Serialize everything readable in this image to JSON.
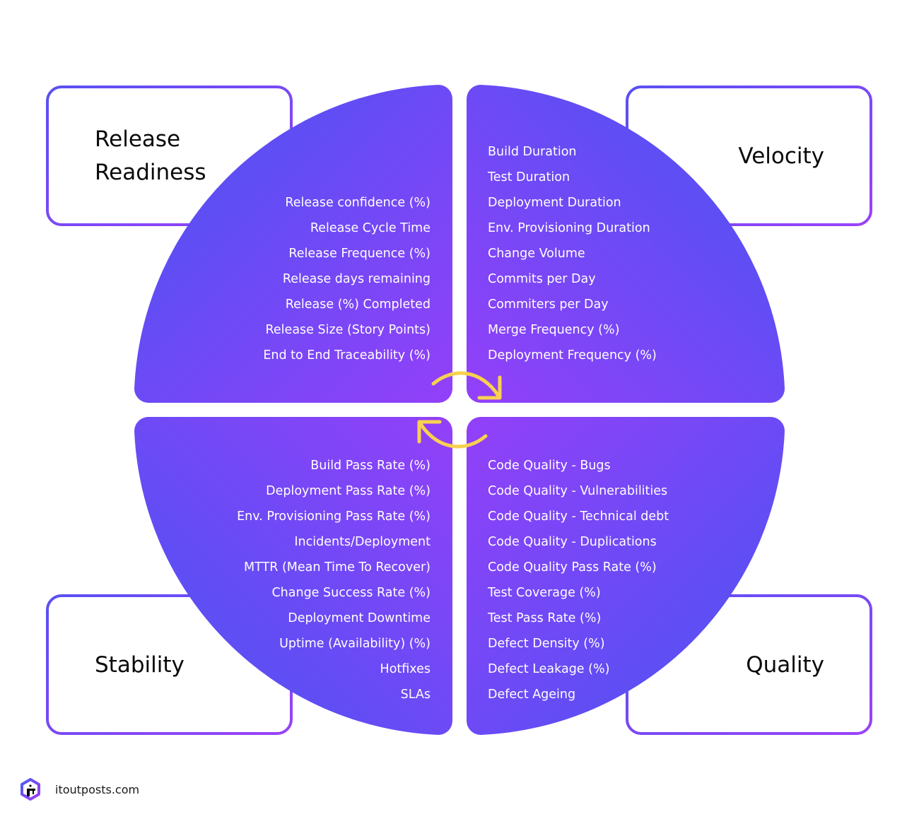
{
  "colors": {
    "quadrant_outer": "#5e4ef4",
    "quadrant_inner": "#9140f9",
    "box_border_start": "#5a50f2",
    "box_border_end": "#9a42f8",
    "arrow": "#f8d14f",
    "title_text": "#0a0a0a",
    "metric_text": "#ffffff"
  },
  "categories": {
    "release_readiness": {
      "title_lines": [
        "Release",
        "Readiness"
      ]
    },
    "velocity": {
      "title_lines": [
        "Velocity"
      ]
    },
    "stability": {
      "title_lines": [
        "Stability"
      ]
    },
    "quality": {
      "title_lines": [
        "Quality"
      ]
    }
  },
  "quadrants": {
    "release_readiness": {
      "metrics": [
        "Release confidence (%)",
        "Release Cycle Time",
        "Release Frequence (%)",
        "Release days remaining",
        "Release (%) Completed",
        "Release Size (Story Points)",
        "End to End Traceability (%)"
      ]
    },
    "velocity": {
      "metrics": [
        "Build Duration",
        "Test Duration",
        "Deployment Duration",
        "Env. Provisioning Duration",
        "Change Volume",
        "Commits per Day",
        "Commiters per Day",
        "Merge Frequency (%)",
        "Deployment Frequency (%)"
      ]
    },
    "stability": {
      "metrics": [
        "Build Pass Rate (%)",
        "Deployment Pass Rate (%)",
        "Env. Provisioning Pass Rate (%)",
        "Incidents/Deployment",
        "MTTR (Mean Time To Recover)",
        "Change Success Rate (%)",
        "Deployment Downtime",
        "Uptime (Availability) (%)",
        "Hotfixes",
        "SLAs"
      ]
    },
    "quality": {
      "metrics": [
        "Code Quality - Bugs",
        "Code Quality - Vulnerabilities",
        "Code Quality - Technical debt",
        "Code Quality - Duplications",
        "Code Quality Pass Rate (%)",
        "Test Coverage (%)",
        "Test Pass Rate (%)",
        "Defect Density (%)",
        "Defect Leakage (%)",
        "Defect Ageing"
      ]
    }
  },
  "center": {
    "icon": "cycle-arrows-icon"
  },
  "footer": {
    "logo_icon": "itoutposts-logo-icon",
    "site": "itoutposts.com"
  }
}
